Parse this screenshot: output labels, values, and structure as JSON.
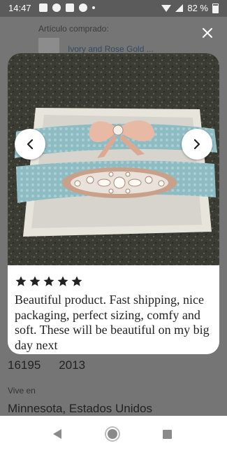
{
  "status_bar": {
    "time": "14:47",
    "battery": "82 %"
  },
  "background_page": {
    "purchased_label": "Artículo comprado:",
    "purchased_item": "Ivory and Rose Gold ...",
    "stats": [
      "16195",
      "2013"
    ],
    "lives_label": "Vive en",
    "location": "Minnesota, Estados Unidos"
  },
  "modal": {
    "rating": 5,
    "review_text": "Beautiful product. Fast shipping, nice packaging, perfect sizing, comfy and soft. These will be beautiful on my big day next"
  },
  "colors": {
    "accent_star": "#222222",
    "scrim": "#6b6b6b"
  },
  "icons": {
    "close": "close-icon",
    "prev": "chevron-left-icon",
    "next": "chevron-right-icon",
    "star": "star-icon"
  }
}
